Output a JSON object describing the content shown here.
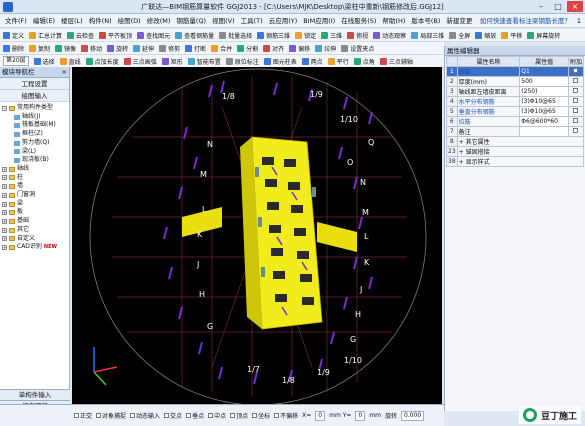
{
  "title": "广联达—BIM钢筋算量软件 GGJ2013 - [C:\\Users\\MJK\\Desktop\\梁柱中重新\\钢筋修改后.GGJ12]",
  "menu": [
    "文件(F)",
    "编辑(E)",
    "楼层(L)",
    "构件(N)",
    "绘图(D)",
    "修改(M)",
    "钢筋量(Q)",
    "视图(V)",
    "工具(T)",
    "云应用(Y)",
    "BIM应用(I)",
    "在线服务(S)",
    "帮助(H)",
    "版本号(B)",
    "新建变更"
  ],
  "menu_right": {
    "question": "如何快速查看标注梁钢筋长度？",
    "count": "1"
  },
  "toolbar1": [
    "定义",
    "汇总计算",
    "云检查",
    "平齐板顶",
    "查找图元",
    "查看钢筋量",
    "批量选择",
    "钢筋三维",
    "锁定",
    "三维",
    "俯视",
    "动态观察",
    "局部三维",
    "全屏",
    "缩放",
    "平移",
    "屏幕旋转"
  ],
  "toolbar2": [
    "删除",
    "复制",
    "镜像",
    "移动",
    "旋转",
    "延伸",
    "修剪",
    "打断",
    "合并",
    "分割",
    "对齐",
    "偏移",
    "拉伸",
    "设置夹点"
  ],
  "toolbar3": {
    "floor": "第20层",
    "items": [
      "选择",
      "直线",
      "点加长度",
      "三点画弧",
      "矩形",
      "智能布置",
      "原位标注",
      "图元柱表"
    ],
    "items2": [
      "两点",
      "平行",
      "点角",
      "三点辅轴"
    ]
  },
  "left_panel": {
    "header": "模块导航栏",
    "btn_project": "工程设置",
    "btn_draw": "绘图输入",
    "tree": [
      {
        "level": 1,
        "label": "常用构件类型",
        "icon": "expand"
      },
      {
        "level": 2,
        "label": "轴线(J)"
      },
      {
        "level": 2,
        "label": "筏板基础(M)"
      },
      {
        "level": 2,
        "label": "框柱(Z)"
      },
      {
        "level": 2,
        "label": "剪力墙(Q)"
      },
      {
        "level": 2,
        "label": "梁(L)"
      },
      {
        "level": 2,
        "label": "现浇板(B)"
      },
      {
        "level": 1,
        "label": "轴线",
        "icon": "collapse"
      },
      {
        "level": 1,
        "label": "柱",
        "icon": "collapse"
      },
      {
        "level": 1,
        "label": "墙",
        "icon": "collapse"
      },
      {
        "level": 1,
        "label": "门窗洞",
        "icon": "collapse"
      },
      {
        "level": 1,
        "label": "梁",
        "icon": "collapse"
      },
      {
        "level": 1,
        "label": "板",
        "icon": "collapse"
      },
      {
        "level": 1,
        "label": "基础",
        "icon": "collapse"
      },
      {
        "level": 1,
        "label": "其它",
        "icon": "collapse"
      },
      {
        "level": 1,
        "label": "自定义",
        "icon": "collapse"
      },
      {
        "level": 1,
        "label": "CAD识别",
        "icon": "collapse",
        "badge": "NEW"
      }
    ],
    "bottom": [
      "单构件输入",
      "报表预览"
    ]
  },
  "viewport": {
    "top_labels": [
      "1/8",
      "1/9",
      "1/10"
    ],
    "bottom_labels": [
      "1/7",
      "1/8",
      "1/9",
      "1/10"
    ],
    "left_labels": [
      "N",
      "M",
      "L",
      "K",
      "J",
      "H",
      "G"
    ],
    "right_labels": [
      "Q",
      "O",
      "N",
      "M",
      "L",
      "K",
      "J",
      "H",
      "G"
    ]
  },
  "right_panel": {
    "header": "属性编辑器",
    "columns": [
      "属性名称",
      "属性值",
      "附加"
    ],
    "rows": [
      {
        "n": "1",
        "name": "名称",
        "value": "Q1",
        "blue": true,
        "selected": true
      },
      {
        "n": "2",
        "name": "厚度(mm)",
        "value": "500"
      },
      {
        "n": "3",
        "name": "轴线距左墙皮距离",
        "value": "(250)"
      },
      {
        "n": "4",
        "name": "水平分布钢筋",
        "value": "(3)Φ10@65",
        "blue": true
      },
      {
        "n": "5",
        "name": "垂直分布钢筋",
        "value": "(3)Φ10@65",
        "blue": true
      },
      {
        "n": "6",
        "name": "拉筋",
        "value": "Φ6@600*60",
        "blue": true
      },
      {
        "n": "7",
        "name": "备注",
        "value": ""
      },
      {
        "n": "8",
        "name": "其它属性",
        "value": "",
        "group": true
      },
      {
        "n": "23",
        "name": "锚固搭接",
        "value": "",
        "group": true
      },
      {
        "n": "38",
        "name": "显示样式",
        "value": "",
        "group": true
      }
    ]
  },
  "status": {
    "items": [
      "正交",
      "对象捕捉",
      "动态输入",
      "交点",
      "垂点",
      "中点",
      "顶点",
      "坐标",
      "不偏移"
    ],
    "x_label": "X=",
    "x_value": "0",
    "y_label": "mm Y=",
    "y_value": "0",
    "unit": "mm",
    "rotate_label": "旋转",
    "rotate_value": "0.000"
  },
  "watermark": "豆丁施工",
  "colors": {
    "accent": "#3d6fc4",
    "structure": "#f2ec1c",
    "rebar": "#7a2ad1",
    "grid": "#c24a5a"
  }
}
